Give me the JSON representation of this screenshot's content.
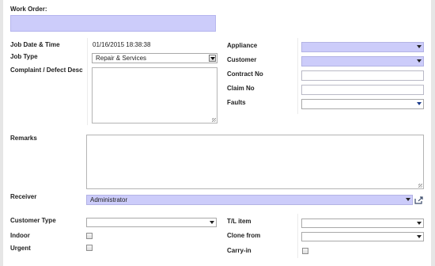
{
  "work_order": {
    "label": "Work Order:",
    "value": ""
  },
  "left": {
    "job_date_label": "Job Date & Time",
    "job_date_value": "01/16/2015 18:38:38",
    "job_type_label": "Job Type",
    "job_type_value": "Repair & Services",
    "complaint_label": "Complaint / Defect Desc",
    "complaint_value": ""
  },
  "right": {
    "appliance_label": "Appliance",
    "appliance_value": "",
    "customer_label": "Customer",
    "customer_value": "",
    "contract_label": "Contract No",
    "contract_value": "",
    "claim_label": "Claim No",
    "claim_value": "",
    "faults_label": "Faults",
    "faults_value": ""
  },
  "remarks": {
    "label": "Remarks",
    "value": ""
  },
  "receiver": {
    "label": "Receiver",
    "value": "Administrator",
    "popout_icon": "external-link-icon"
  },
  "bottom_left": {
    "customer_type_label": "Customer Type",
    "customer_type_value": "",
    "indoor_label": "Indoor",
    "indoor_checked": false,
    "urgent_label": "Urgent",
    "urgent_checked": false
  },
  "bottom_right": {
    "tl_item_label": "T/L item",
    "tl_item_value": "",
    "clone_from_label": "Clone from",
    "clone_from_value": "",
    "carry_in_label": "Carry-in",
    "carry_in_checked": false
  },
  "colors": {
    "required_bg": "#ccccfa",
    "frame": "#e6e6e6",
    "label": "#222222"
  }
}
